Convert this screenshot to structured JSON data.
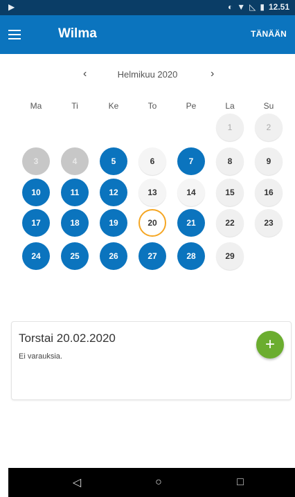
{
  "status_bar": {
    "left_icon": "play-icon",
    "time": "12.51"
  },
  "app_bar": {
    "title": "Wilma",
    "today_label": "TÄNÄÄN"
  },
  "calendar": {
    "month_label": "Helmikuu 2020",
    "weekdays": [
      "Ma",
      "Ti",
      "Ke",
      "To",
      "Pe",
      "La",
      "Su"
    ],
    "colors": {
      "blue": "#0b74be",
      "gray": "#c7c7c7",
      "today_ring": "#f5a623"
    }
  },
  "days": {
    "d1": "1",
    "d2": "2",
    "d3": "3",
    "d4": "4",
    "d5": "5",
    "d6": "6",
    "d7": "7",
    "d8": "8",
    "d9": "9",
    "d10": "10",
    "d11": "11",
    "d12": "12",
    "d13": "13",
    "d14": "14",
    "d15": "15",
    "d16": "16",
    "d17": "17",
    "d18": "18",
    "d19": "19",
    "d20": "20",
    "d21": "21",
    "d22": "22",
    "d23": "23",
    "d24": "24",
    "d25": "25",
    "d26": "26",
    "d27": "27",
    "d28": "28",
    "d29": "29"
  },
  "card": {
    "date": "Torstai 20.02.2020",
    "message": "Ei varauksia.",
    "add_label": "+"
  },
  "nav": {
    "back": "◁",
    "home": "○",
    "recent": "□"
  }
}
